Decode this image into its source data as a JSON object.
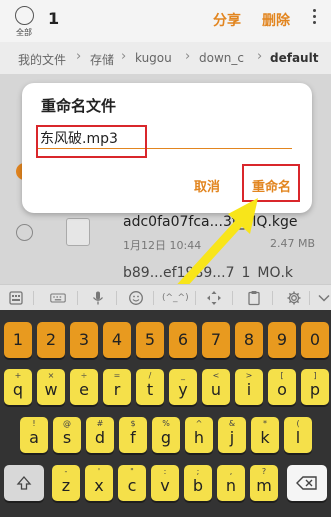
{
  "topbar": {
    "select_all_label": "全部",
    "count": "1",
    "share_label": "分享",
    "delete_label": "删除"
  },
  "breadcrumb": [
    "我的文件",
    "存储",
    "kugou",
    "down_c",
    "default"
  ],
  "dialog": {
    "title": "重命名文件",
    "input_value": "东风破.mp3",
    "cancel_label": "取消",
    "rename_label": "重命名"
  },
  "file": {
    "name": "adc0fa07fca...3t_MQ.kge",
    "date": "1月12日 10:44",
    "size": "2.47 MB",
    "next_name": "b89...ef1989...7_1_MQ.k"
  },
  "keyboard": {
    "rows": [
      [
        {
          "main": "1"
        },
        {
          "main": "2"
        },
        {
          "main": "3"
        },
        {
          "main": "4"
        },
        {
          "main": "5"
        },
        {
          "main": "6"
        },
        {
          "main": "7"
        },
        {
          "main": "8"
        },
        {
          "main": "9"
        },
        {
          "main": "0"
        }
      ],
      [
        {
          "main": "q",
          "sym": "+"
        },
        {
          "main": "w",
          "sym": "×"
        },
        {
          "main": "e",
          "sym": "÷"
        },
        {
          "main": "r",
          "sym": "="
        },
        {
          "main": "t",
          "sym": "/"
        },
        {
          "main": "y",
          "sym": "_"
        },
        {
          "main": "u",
          "sym": "<"
        },
        {
          "main": "i",
          "sym": ">"
        },
        {
          "main": "o",
          "sym": "["
        },
        {
          "main": "p",
          "sym": "]"
        }
      ],
      [
        {
          "main": "a",
          "sym": "!"
        },
        {
          "main": "s",
          "sym": "@"
        },
        {
          "main": "d",
          "sym": "#"
        },
        {
          "main": "f",
          "sym": "$"
        },
        {
          "main": "g",
          "sym": "%"
        },
        {
          "main": "h",
          "sym": "^"
        },
        {
          "main": "j",
          "sym": "&"
        },
        {
          "main": "k",
          "sym": "*"
        },
        {
          "main": "l",
          "sym": "("
        }
      ],
      [
        {
          "main": "z",
          "sym": "-"
        },
        {
          "main": "x",
          "sym": "'"
        },
        {
          "main": "c",
          "sym": "\""
        },
        {
          "main": "v",
          "sym": ":"
        },
        {
          "main": "b",
          "sym": ";"
        },
        {
          "main": "n",
          "sym": ","
        },
        {
          "main": "m",
          "sym": "?"
        }
      ]
    ]
  },
  "colors": {
    "accent": "#e2851f",
    "highlight_box": "#d9262b",
    "key_letter": "#f5e04a",
    "key_number": "#e89a1f",
    "keyboard_bg": "#333333"
  }
}
